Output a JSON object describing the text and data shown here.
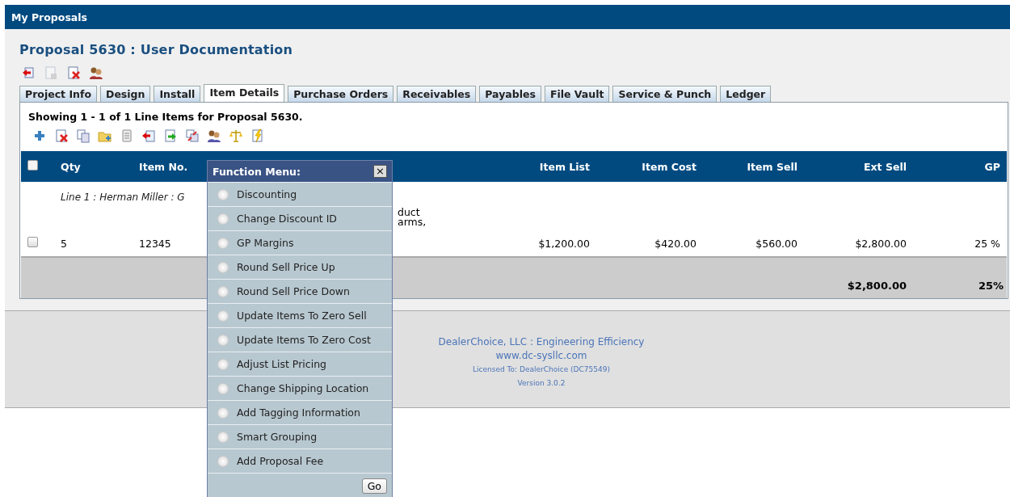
{
  "header": {
    "title": "My Proposals"
  },
  "page_title": "Proposal 5630 : User Documentation",
  "toolbar": [
    {
      "disabled": false
    },
    {
      "disabled": true
    },
    {
      "disabled": false
    },
    {
      "disabled": false
    }
  ],
  "tabs": [
    {
      "label": "Project Info",
      "selected": false
    },
    {
      "label": "Design",
      "selected": false
    },
    {
      "label": "Install",
      "selected": false
    },
    {
      "label": "Item Details",
      "selected": true
    },
    {
      "label": "Purchase Orders",
      "selected": false
    },
    {
      "label": "Receivables",
      "selected": false
    },
    {
      "label": "Payables",
      "selected": false
    },
    {
      "label": "File Vault",
      "selected": false
    },
    {
      "label": "Service & Punch",
      "selected": false
    },
    {
      "label": "Ledger",
      "selected": false
    }
  ],
  "showing": "Showing 1 - 1 of 1 Line Items for Proposal 5630.",
  "item_toolbar": [
    {
      "disabled": false
    },
    {
      "disabled": false
    },
    {
      "disabled": false
    },
    {
      "disabled": false
    },
    {
      "disabled": false
    },
    {
      "disabled": false
    },
    {
      "disabled": false
    },
    {
      "disabled": false
    },
    {
      "disabled": false
    },
    {
      "disabled": false
    },
    {
      "disabled": false
    }
  ],
  "table": {
    "select_all": {
      "checked": false
    },
    "columns": [
      "Qty",
      "Item No.",
      "",
      "Item List",
      "Item Cost",
      "Item Sell",
      "Ext Sell",
      "GP"
    ],
    "rows": [
      {
        "line_label": "Line 1 :  Herman Miller : G",
        "checked": false,
        "qty": "5",
        "item_no": "12345",
        "description_lines": [
          "duct",
          "arms,"
        ],
        "item_list": "$1,200.00",
        "item_cost": "$420.00",
        "item_sell": "$560.00",
        "ext_sell": "$2,800.00",
        "gp": "25 %"
      }
    ],
    "totals": {
      "ext_sell": "$2,800.00",
      "gp": "25%"
    }
  },
  "function_menu": {
    "title": "Function Menu:",
    "close": "×",
    "items": [
      {
        "label": "Discounting",
        "selected": false
      },
      {
        "label": "Change Discount ID",
        "selected": false
      },
      {
        "label": "GP Margins",
        "selected": false
      },
      {
        "label": "Round Sell Price Up",
        "selected": false
      },
      {
        "label": "Round Sell Price Down",
        "selected": false
      },
      {
        "label": "Update Items To Zero Sell",
        "selected": false
      },
      {
        "label": "Update Items To Zero Cost",
        "selected": false
      },
      {
        "label": "Adjust List Pricing",
        "selected": false
      },
      {
        "label": "Change Shipping Location",
        "selected": false
      },
      {
        "label": "Add Tagging Information",
        "selected": false
      },
      {
        "label": "Smart Grouping",
        "selected": false
      },
      {
        "label": "Add Proposal Fee",
        "selected": false
      }
    ],
    "button": "Go"
  },
  "footer": {
    "company": "DealerChoice, LLC : Engineering Efficiency",
    "website": "www.dc-sysllc.com",
    "license": "Licensed To: DealerChoice (DC75549)",
    "version": "Version 3.0.2"
  }
}
